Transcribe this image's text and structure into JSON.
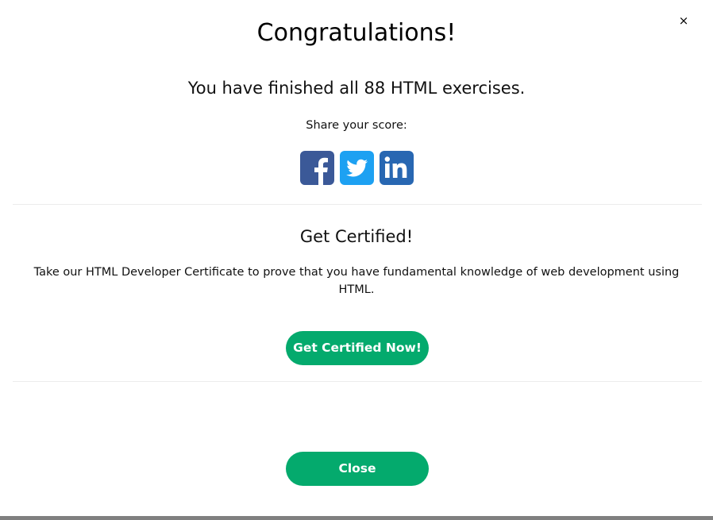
{
  "modal": {
    "close_icon_glyph": "×",
    "title": "Congratulations!",
    "finished_text": "You have finished all 88 HTML exercises.",
    "share_label": "Share your score:",
    "share_buttons": [
      {
        "icon": "facebook-icon",
        "color": "#3b5998"
      },
      {
        "icon": "twitter-icon",
        "color": "#1da1f2"
      },
      {
        "icon": "linkedin-icon",
        "color": "#2867b2"
      }
    ],
    "certified": {
      "title": "Get Certified!",
      "description": "Take our HTML Developer Certificate to prove that you have fundamental knowledge of web development using HTML.",
      "button_label": "Get Certified Now!"
    },
    "close_button_label": "Close"
  },
  "colors": {
    "accent_green": "#04aa6d",
    "divider": "#ececec"
  }
}
